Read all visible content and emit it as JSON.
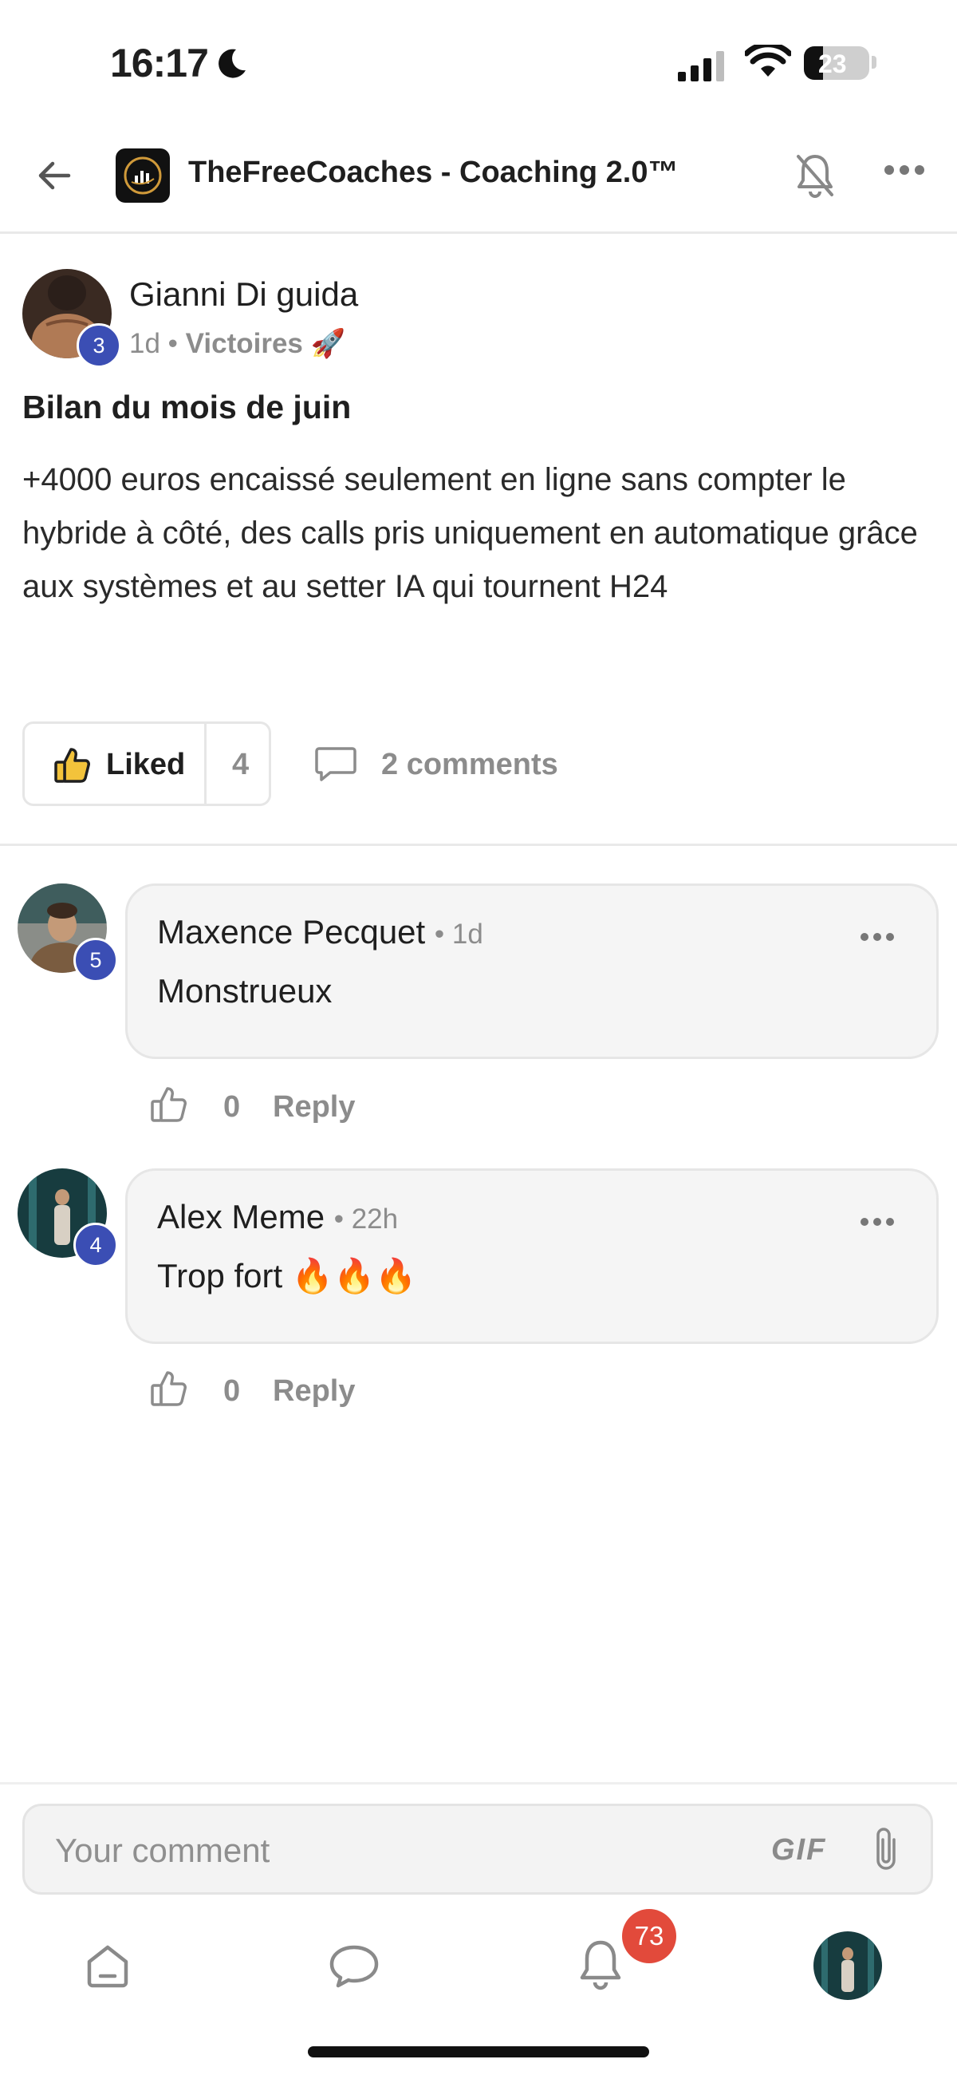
{
  "status_bar": {
    "time": "16:17",
    "battery": "23"
  },
  "header": {
    "group_name": "TheFreeCoaches - Coaching 2.0™"
  },
  "post": {
    "author": "Gianni Di guida",
    "author_level": "3",
    "time": "1d",
    "separator": "•",
    "category": "Victoires",
    "category_emoji": "🚀",
    "title": "Bilan du mois de juin",
    "body": "+4000 euros encaissé seulement en ligne sans compter le hybride à côté, des calls pris uniquement en automatique grâce aux systèmes et au setter IA qui tournent H24",
    "liked_label": "Liked",
    "like_count": "4",
    "comments_label": "2 comments"
  },
  "comments": [
    {
      "author": "Maxence Pecquet",
      "level": "5",
      "time": "• 1d",
      "text": "Monstrueux",
      "likes": "0",
      "reply_label": "Reply"
    },
    {
      "author": "Alex Meme",
      "level": "4",
      "time": "• 22h",
      "text": "Trop fort 🔥🔥🔥",
      "likes": "0",
      "reply_label": "Reply"
    }
  ],
  "comment_input": {
    "placeholder": "Your comment",
    "gif_label": "GIF"
  },
  "bottom_nav": {
    "notification_count": "73"
  },
  "colors": {
    "level_badge": "#3b4eb4",
    "notification_badge": "#e24a3b",
    "muted_text": "#8c8c8c"
  },
  "icons": [
    "arrow-left-icon",
    "bell-off-icon",
    "more-icon",
    "thumbs-up-icon",
    "comment-icon",
    "paperclip-icon",
    "home-icon",
    "chat-icon",
    "bell-icon"
  ]
}
